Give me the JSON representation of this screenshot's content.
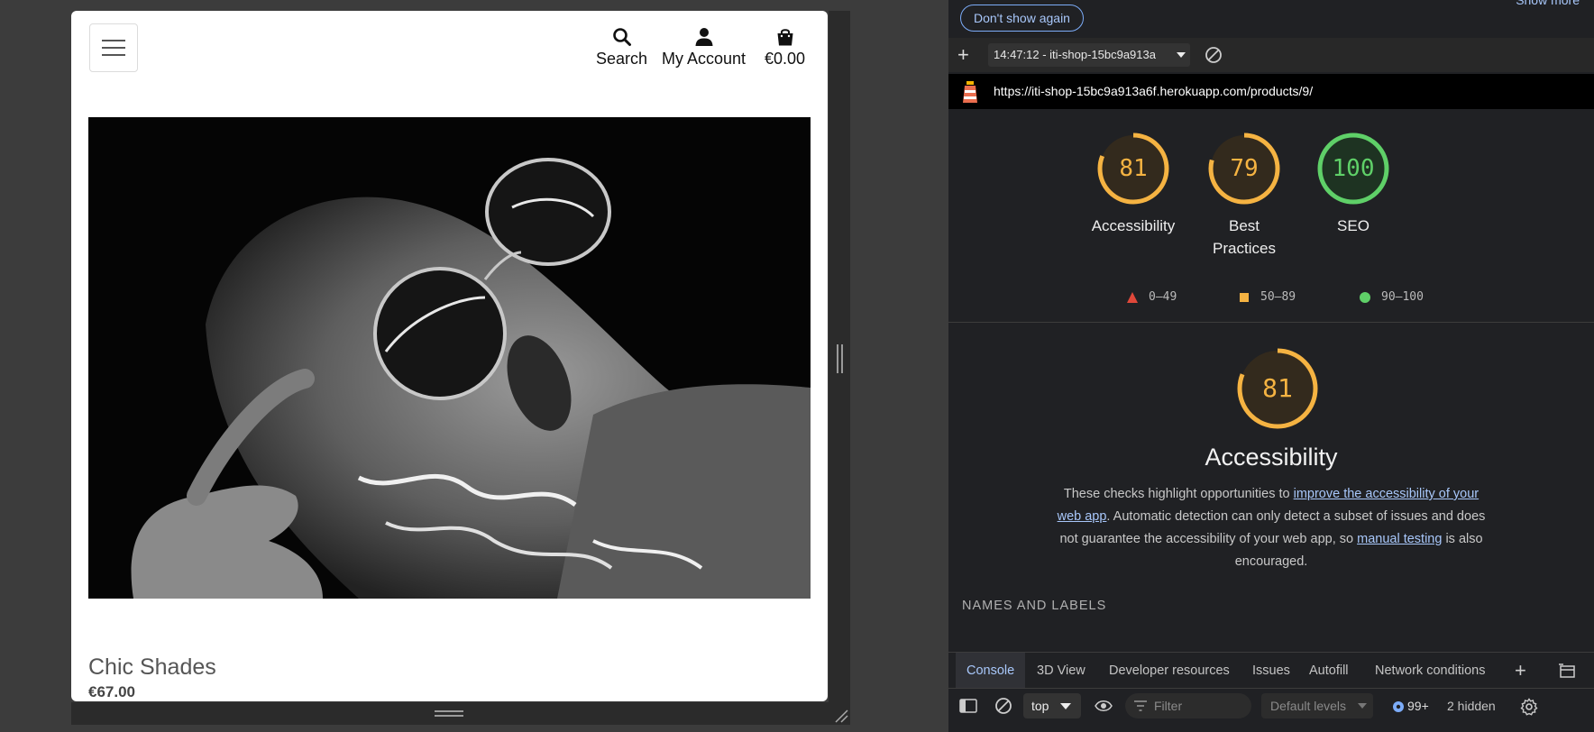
{
  "site": {
    "nav": {
      "search_label": "Search",
      "account_label": "My Account",
      "bag_total": "€0.00"
    },
    "product": {
      "name": "Chic Shades",
      "price": "€67.00"
    }
  },
  "devtools": {
    "dont_show_label": "Don't show again",
    "show_more_label": "Show more",
    "report_selector": "14:47:12 - iti-shop-15bc9a913a",
    "url": "https://iti-shop-15bc9a913a6f.herokuapp.com/products/9/",
    "gauges": [
      {
        "score": "81",
        "label": "Accessibility",
        "color": "#f5b342"
      },
      {
        "score": "79",
        "label": "Best Practices",
        "color": "#f5b342"
      },
      {
        "score": "100",
        "label": "SEO",
        "color": "#5fd068"
      }
    ],
    "legend": [
      {
        "range": "0–49",
        "color": "#e0483a"
      },
      {
        "range": "50–89",
        "color": "#f5b342"
      },
      {
        "range": "90–100",
        "color": "#5fd068"
      }
    ],
    "section": {
      "score": "81",
      "title": "Accessibility",
      "desc_1": "These checks highlight opportunities to ",
      "desc_link_1": "improve the accessibility of your web app",
      "desc_2": ". Automatic detection can only detect a subset of issues and does not guarantee the accessibility of your web app, so ",
      "desc_link_2": "manual testing",
      "desc_3": " is also encouraged.",
      "group_heading": "NAMES AND LABELS"
    },
    "drawer_tabs": [
      "Console",
      "3D View",
      "Developer resources",
      "Issues",
      "Autofill",
      "Network conditions"
    ],
    "toolbar": {
      "context": "top",
      "filter_placeholder": "Filter",
      "levels": "Default levels",
      "messages": "99+",
      "hidden": "2 hidden"
    }
  }
}
